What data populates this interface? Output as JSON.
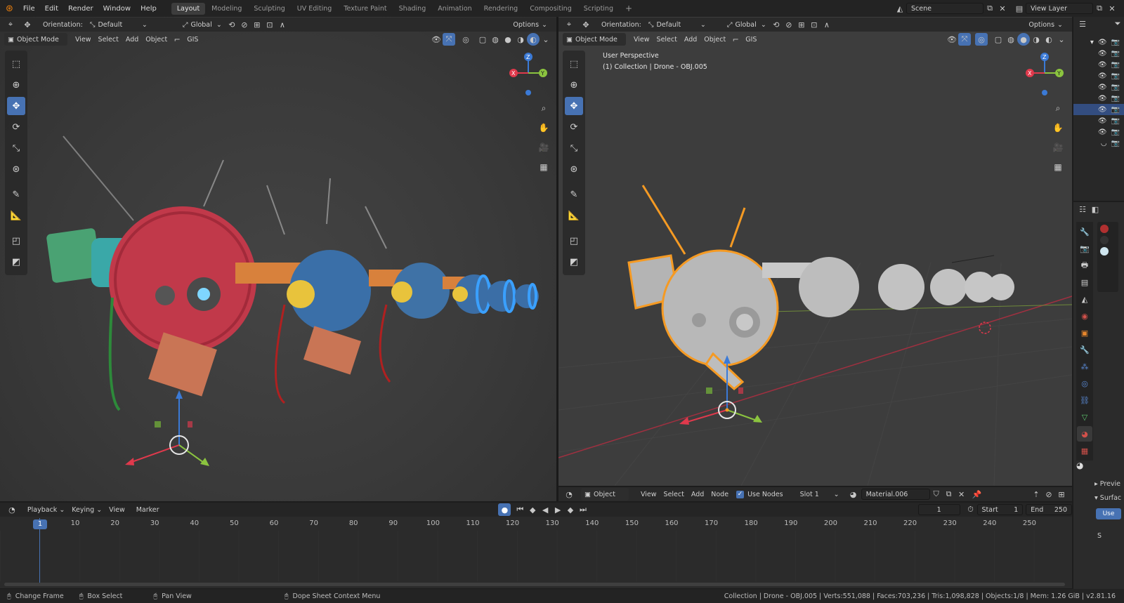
{
  "menu": {
    "file": "File",
    "edit": "Edit",
    "render": "Render",
    "window": "Window",
    "help": "Help"
  },
  "workspaces": [
    "Layout",
    "Modeling",
    "Sculpting",
    "UV Editing",
    "Texture Paint",
    "Shading",
    "Animation",
    "Rendering",
    "Compositing",
    "Scripting"
  ],
  "scene": {
    "name": "Scene",
    "view_layer": "View Layer"
  },
  "left_vp": {
    "orientation_label": "Orientation:",
    "orientation_value": "Default",
    "transform_space": "Global",
    "options": "Options",
    "mode": "Object Mode",
    "view": "View",
    "select": "Select",
    "add": "Add",
    "object": "Object",
    "gis": "GIS"
  },
  "right_vp": {
    "orientation_label": "Orientation:",
    "orientation_value": "Default",
    "transform_space": "Global",
    "options": "Options",
    "mode": "Object Mode",
    "view": "View",
    "select": "Select",
    "add": "Add",
    "object": "Object",
    "gis": "GIS",
    "overlay_title": "User Perspective",
    "overlay_collection": "(1) Collection | Drone - OBJ.005"
  },
  "shader": {
    "object": "Object",
    "view": "View",
    "select": "Select",
    "add": "Add",
    "node": "Node",
    "use_nodes": "Use Nodes",
    "slot": "Slot 1",
    "material": "Material.006"
  },
  "timeline": {
    "playback": "Playback",
    "keying": "Keying",
    "view": "View",
    "marker": "Marker",
    "current_frame": "1",
    "start_label": "Start",
    "start_value": "1",
    "end_label": "End",
    "end_value": "250",
    "ticks": [
      "1",
      "10",
      "20",
      "30",
      "40",
      "50",
      "60",
      "70",
      "80",
      "90",
      "100",
      "110",
      "120",
      "130",
      "140",
      "150",
      "160",
      "170",
      "180",
      "190",
      "200",
      "210",
      "220",
      "230",
      "240",
      "250"
    ]
  },
  "status": {
    "change_frame": "Change Frame",
    "box_select": "Box Select",
    "pan_view": "Pan View",
    "dope_sheet": "Dope Sheet Context Menu",
    "stats": "Collection | Drone - OBJ.005 | Verts:551,088 | Faces:703,236 | Tris:1,098,828 | Objects:1/8 | Mem: 1.26 GiB | v2.81.16"
  },
  "properties": {
    "preview": "Previe",
    "surface": "Surfac",
    "use": "Use",
    "s": "S"
  },
  "colors": {
    "accent": "#4772b3",
    "selection": "#f59a23",
    "x_axis": "#e0394c",
    "y_axis": "#8bc43f",
    "z_axis": "#3b7ad6"
  }
}
